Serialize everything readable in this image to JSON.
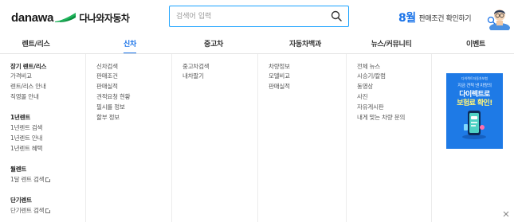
{
  "header": {
    "logo_en": "danawa",
    "logo_ko": "다나와자동차",
    "search_placeholder": "검색어 입력",
    "promo_month": "8월",
    "promo_text": "판매조건 확인하기"
  },
  "gnb": [
    {
      "label": "렌트/리스",
      "active": false
    },
    {
      "label": "신차",
      "active": true
    },
    {
      "label": "중고차",
      "active": false
    },
    {
      "label": "자동차백과",
      "active": false
    },
    {
      "label": "뉴스/커뮤니티",
      "active": false
    },
    {
      "label": "이벤트",
      "active": false
    }
  ],
  "rent_menu": {
    "long_term_head": "장기 렌트/리스",
    "long_term_items": [
      "가격비교",
      "렌트/리스 안내",
      "직영몰 안내"
    ],
    "one_year_head": "1년렌트",
    "one_year_items": [
      "1년렌트 검색",
      "1년렌트 안내",
      "1년렌트 혜택"
    ],
    "monthly_head": "월렌트",
    "monthly_items": [
      "1달 렌트 검색"
    ],
    "short_term_head": "단기렌트",
    "short_term_items": [
      "단기렌트 검색"
    ]
  },
  "new_car_menu": [
    "신차검색",
    "판매조건",
    "판매실적",
    "견적요청 현황",
    "필시를 정보",
    "할부 정보"
  ],
  "used_car_menu": [
    "중고차검색",
    "내차팔기"
  ],
  "encyclopedia_menu": [
    "차량정보",
    "모델비교",
    "판매실적"
  ],
  "news_menu": [
    "전체 뉴스",
    "시승기/칼럼",
    "동영상",
    "사진",
    "자유게시판",
    "내게 맞는 차량 문의"
  ],
  "banner": {
    "brand": "다이렉트자동차보험",
    "subtitle": "지금 견적 낸 차량의",
    "title_line1": "다이렉트로",
    "title_line2": "보험료 확인!",
    "colors": {
      "background": "#1e7ae6",
      "highlight": "#fff57a"
    }
  },
  "colors": {
    "accent": "#1a73e8",
    "search_border": "#1aa2ff"
  },
  "icons": [
    "danawa-logo-icon",
    "search-icon",
    "consultant-figure-icon",
    "external-link-icon",
    "phone-illustration-icon",
    "close-icon"
  ]
}
